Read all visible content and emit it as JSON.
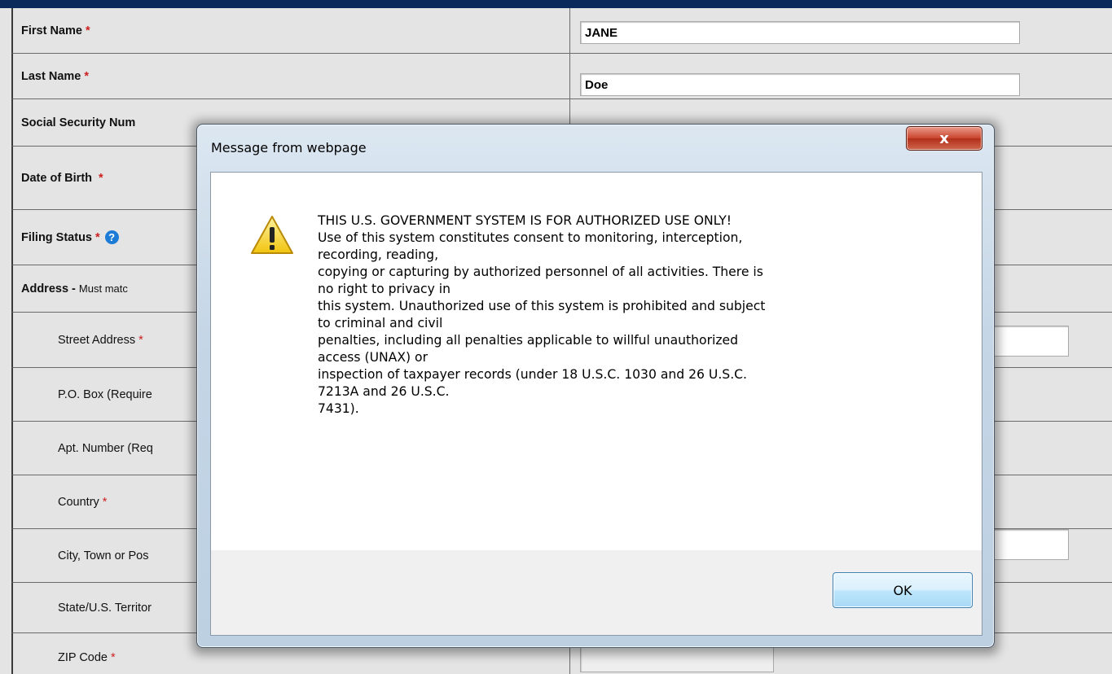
{
  "form": {
    "first_name_label": "First Name",
    "first_name_value": "JANE",
    "last_name_label": "Last Name",
    "last_name_value": "Doe",
    "ssn_label": "Social Security Num",
    "dob_label": "Date of Birth",
    "filing_status_label": "Filing Status",
    "address_label": "Address -",
    "address_hint": "Must matc",
    "street_label": "Street Address",
    "po_box_label": "P.O. Box (Require",
    "apt_label": "Apt. Number (Req",
    "country_label": "Country",
    "city_label": "City, Town or Pos",
    "state_label": "State/U.S. Territor",
    "zip_label": "ZIP Code",
    "required_marker": "*",
    "help_icon_glyph": "?"
  },
  "dialog": {
    "title": "Message from webpage",
    "close_glyph": "x",
    "message_lines": [
      "THIS U.S. GOVERNMENT SYSTEM IS FOR AUTHORIZED USE ONLY!",
      "Use of this system constitutes consent to monitoring, interception,",
      "recording, reading,",
      "copying or capturing by authorized personnel of all activities.  There is",
      "no right to privacy in",
      "this system.  Unauthorized use of this system is prohibited and subject",
      "to criminal and civil",
      "penalties, including all penalties applicable to willful unauthorized",
      "access (UNAX) or",
      "inspection of taxpayer records (under 18 U.S.C. 1030 and 26 U.S.C.",
      "7213A and 26 U.S.C.",
      "7431)."
    ],
    "ok_label": "OK",
    "icon": "warning-icon"
  },
  "colors": {
    "top_bar": "#0a2a5c",
    "required": "#cc1f1f",
    "help_icon": "#1d7bd8",
    "row_bg": "#e4e4e4"
  }
}
